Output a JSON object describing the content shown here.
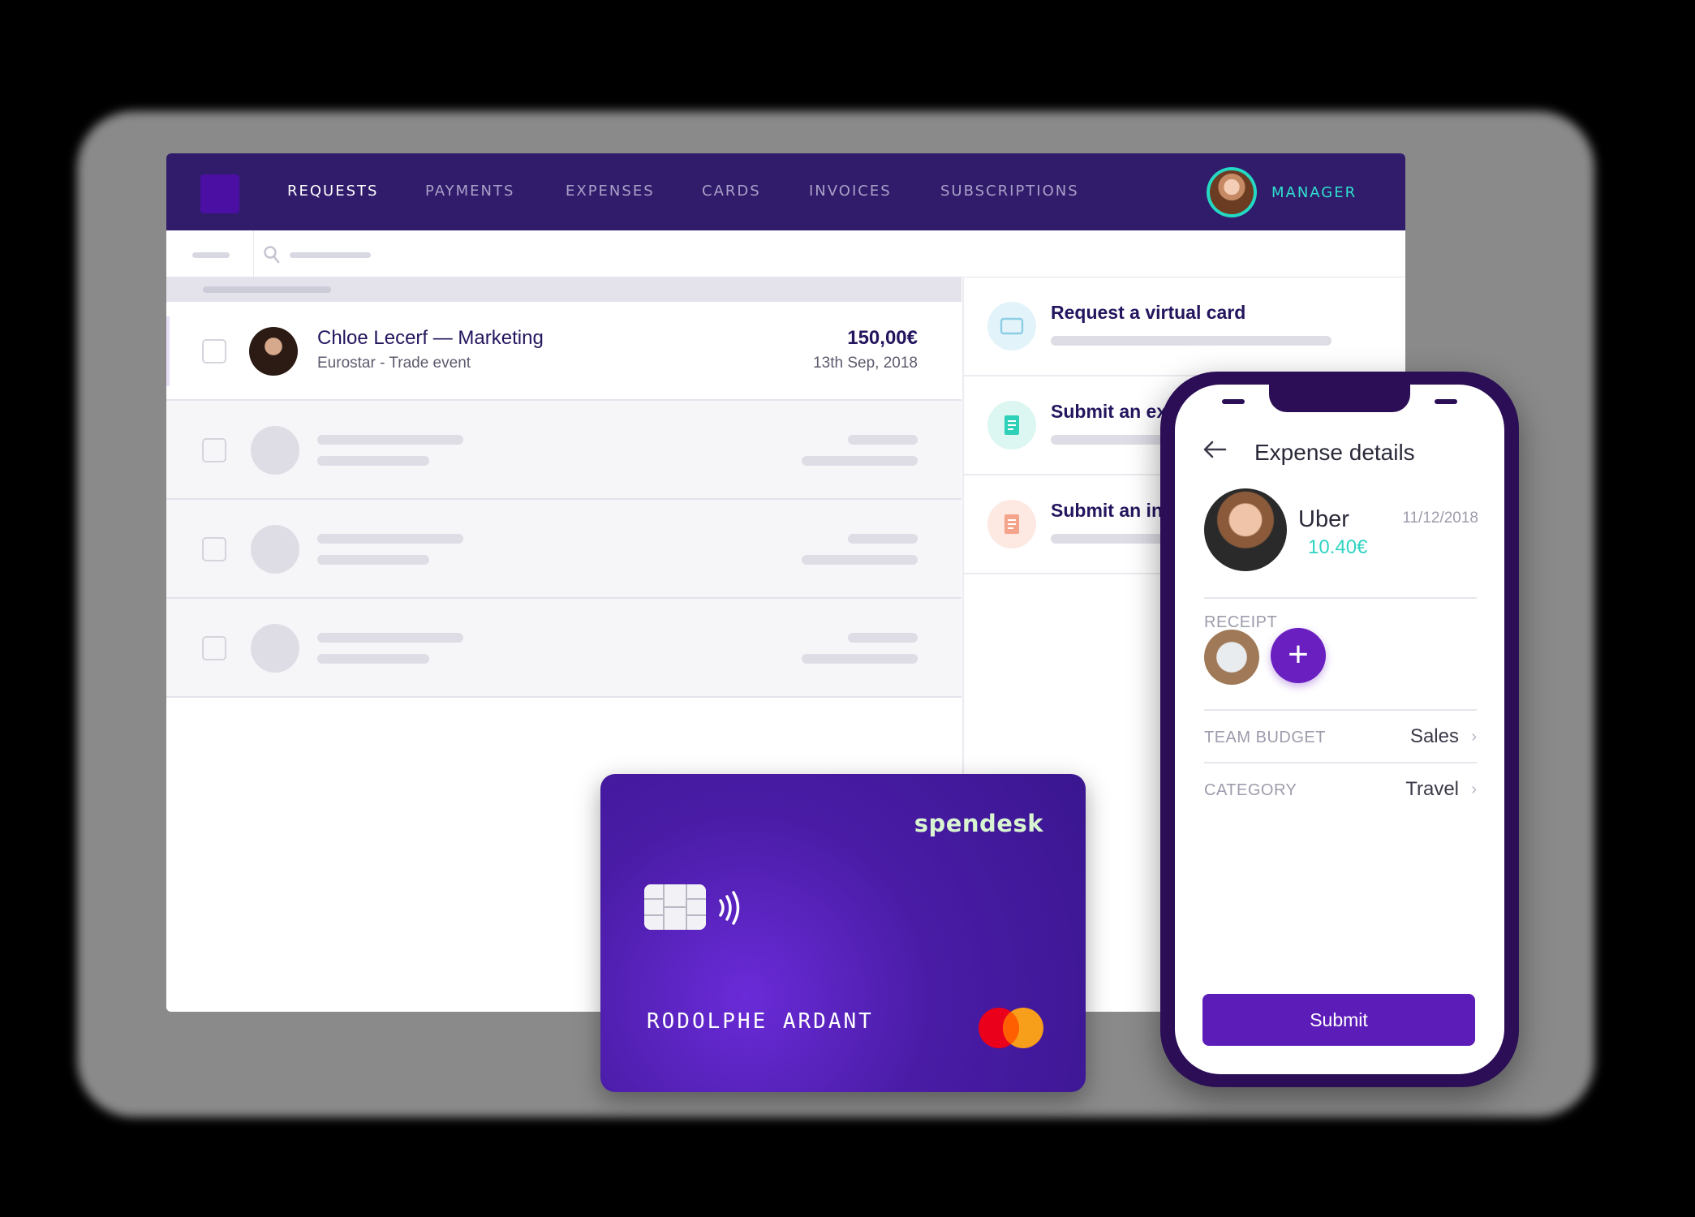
{
  "desktop": {
    "nav": {
      "items": [
        {
          "label": "REQUESTS",
          "active": true
        },
        {
          "label": "PAYMENTS",
          "active": false
        },
        {
          "label": "EXPENSES",
          "active": false
        },
        {
          "label": "CARDS",
          "active": false
        },
        {
          "label": "INVOICES",
          "active": false
        },
        {
          "label": "SUBSCRIPTIONS",
          "active": false
        }
      ],
      "user_role": "MANAGER"
    },
    "requests": [
      {
        "name": "Chloe Lecerf — Marketing",
        "description": "Eurostar - Trade event",
        "amount": "150,00€",
        "date": "13th Sep, 2018"
      }
    ],
    "actions": [
      {
        "title": "Request a virtual card",
        "icon": "card-icon"
      },
      {
        "title": "Submit an ex",
        "icon": "document-icon"
      },
      {
        "title": "Submit an in",
        "icon": "invoice-icon"
      }
    ]
  },
  "card": {
    "brand": "spendesk",
    "holder": "RODOLPHE ARDANT",
    "network_icon": "mastercard-logo"
  },
  "phone": {
    "title": "Expense details",
    "merchant": "Uber",
    "amount": "10.40€",
    "date": "11/12/2018",
    "receipt_label": "RECEIPT",
    "add_receipt_symbol": "+",
    "fields": [
      {
        "label": "TEAM BUDGET",
        "value": "Sales"
      },
      {
        "label": "CATEGORY",
        "value": "Travel"
      }
    ],
    "submit_label": "Submit"
  },
  "colors": {
    "nav_bg": "#311c6b",
    "accent_teal": "#2fe0cf",
    "brand_purple": "#5c1cb8",
    "card_purple": "#4a1ca6"
  }
}
